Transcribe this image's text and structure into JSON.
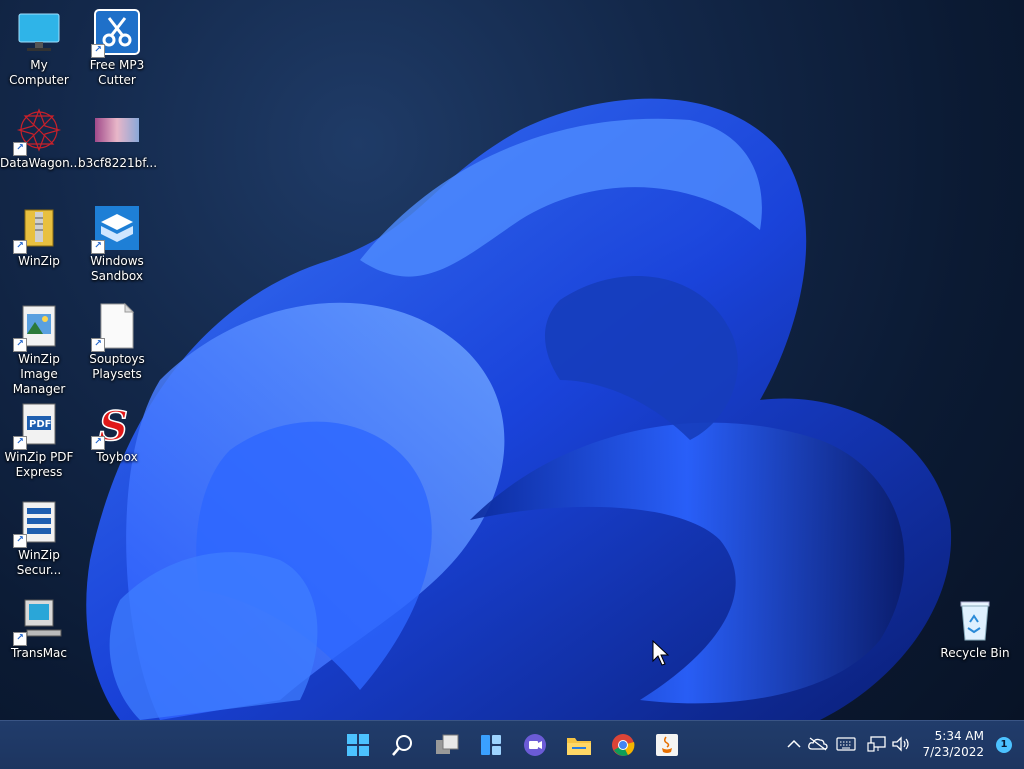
{
  "desktop": {
    "icons": [
      {
        "label": "My Computer",
        "icon": "monitor-icon"
      },
      {
        "label": "Free MP3 Cutter",
        "icon": "scissors-icon"
      },
      {
        "label": "DataWagon...",
        "icon": "star-web-icon"
      },
      {
        "label": "b3cf8221bf...",
        "icon": "image-thumbnail-icon"
      },
      {
        "label": "WinZip",
        "icon": "winzip-icon"
      },
      {
        "label": "Windows Sandbox",
        "icon": "sandbox-icon"
      },
      {
        "label": "WinZip Image Manager",
        "icon": "winzip-image-icon"
      },
      {
        "label": "Souptoys Playsets",
        "icon": "blank-file-icon"
      },
      {
        "label": "WinZip PDF Express",
        "icon": "winzip-pdf-icon"
      },
      {
        "label": "Toybox",
        "icon": "toybox-s-icon"
      },
      {
        "label": "WinZip Secur...",
        "icon": "winzip-secure-icon"
      },
      {
        "label": "TransMac",
        "icon": "transmac-icon"
      },
      {
        "label": "Recycle Bin",
        "icon": "recycle-bin-icon"
      }
    ]
  },
  "taskbar": {
    "apps": [
      {
        "name": "Start",
        "icon": "windows-start-icon"
      },
      {
        "name": "Search",
        "icon": "search-icon"
      },
      {
        "name": "Task View",
        "icon": "task-view-icon"
      },
      {
        "name": "Widgets",
        "icon": "widgets-icon"
      },
      {
        "name": "Chat",
        "icon": "chat-icon"
      },
      {
        "name": "File Explorer",
        "icon": "folder-icon"
      },
      {
        "name": "Google Chrome",
        "icon": "chrome-icon"
      },
      {
        "name": "Java",
        "icon": "java-icon"
      }
    ],
    "tray": {
      "time": "5:34 AM",
      "date": "7/23/2022",
      "notification_count": "1"
    }
  },
  "colors": {
    "taskbar_bg": "#213c6b",
    "accent": "#4cc2ff",
    "wallpaper_blue": "#1d4fe6"
  }
}
